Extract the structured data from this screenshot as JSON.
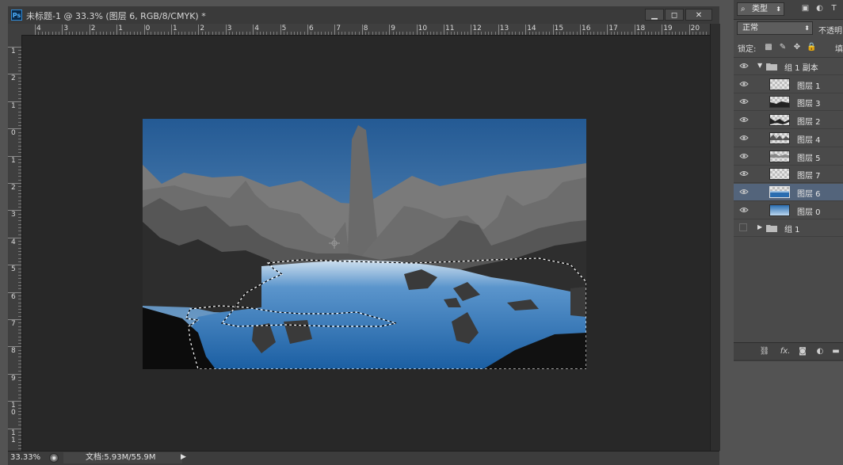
{
  "document": {
    "title": "未标题-1 @ 33.3% (图层 6, RGB/8/CMYK) *",
    "app_icon": "Ps",
    "window_buttons": {
      "minimize": "▁",
      "maximize": "◻",
      "close": "✕"
    }
  },
  "rulers": {
    "horizontal": [
      "4",
      "3",
      "2",
      "1",
      "0",
      "1",
      "2",
      "3",
      "4",
      "5",
      "6",
      "7",
      "8",
      "9",
      "10",
      "11",
      "12",
      "13",
      "14",
      "15",
      "16",
      "17",
      "18",
      "19",
      "20"
    ],
    "vertical": [
      "1",
      "2",
      "1",
      "0",
      "1",
      "2",
      "3",
      "4",
      "5",
      "6",
      "7",
      "8",
      "9",
      "1\n0",
      "1\n1"
    ]
  },
  "status": {
    "zoom": "33.33%",
    "doc_size": "文档:5.93M/55.9M",
    "arrow": "▶"
  },
  "layers_panel": {
    "kind_label": "类型",
    "kind_icon": "search-icon",
    "blend_mode": "正常",
    "opacity_label": "不透明",
    "lock_label": "锁定:",
    "fill_label": "填",
    "layers": [
      {
        "name": "组 1 副本",
        "kind": "group",
        "expanded": true,
        "visible": true
      },
      {
        "name": "图层 1",
        "kind": "layer",
        "visible": true,
        "selected": false
      },
      {
        "name": "图层 3",
        "kind": "layer",
        "visible": true,
        "selected": false
      },
      {
        "name": "图层 2",
        "kind": "layer",
        "visible": true,
        "selected": false
      },
      {
        "name": "图层 4",
        "kind": "layer",
        "visible": true,
        "selected": false
      },
      {
        "name": "图层 5",
        "kind": "layer",
        "visible": true,
        "selected": false
      },
      {
        "name": "图层 7",
        "kind": "layer",
        "visible": true,
        "selected": false
      },
      {
        "name": "图层 6",
        "kind": "layer",
        "visible": true,
        "selected": true
      },
      {
        "name": "图层 0",
        "kind": "layer",
        "visible": true,
        "selected": false
      },
      {
        "name": "组 1",
        "kind": "group",
        "expanded": false,
        "visible": false
      }
    ],
    "footer_icons": [
      "link-icon",
      "fx-icon",
      "mask-icon",
      "adjustment-icon",
      "folder-icon"
    ],
    "footer_fx": "fx."
  },
  "colors": {
    "sky_top": "#245a94",
    "sky_bottom": "#6c9cc8",
    "water": "#1f63a6",
    "selected_row": "#53647b"
  }
}
